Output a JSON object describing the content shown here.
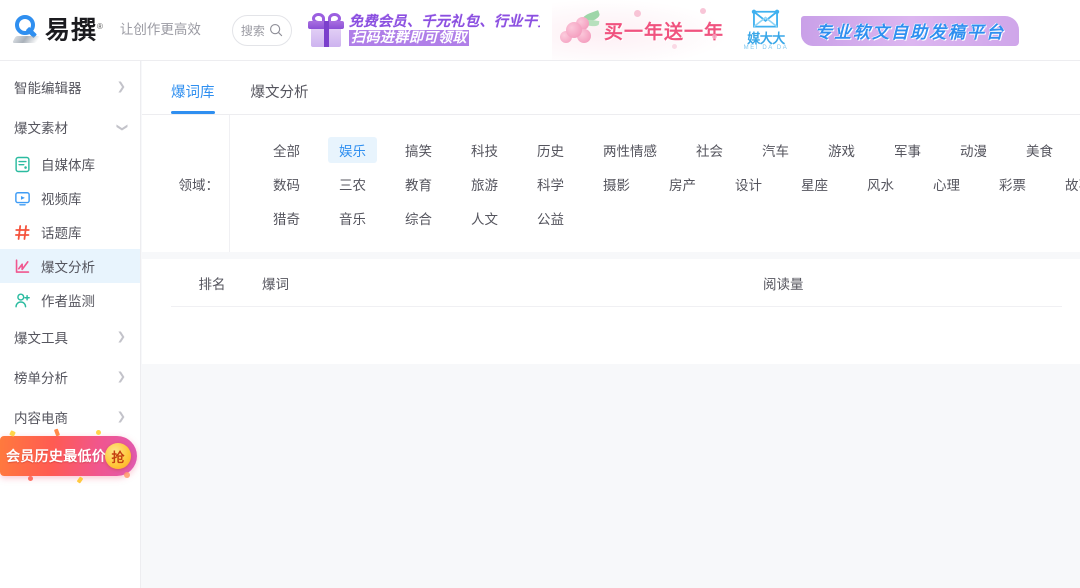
{
  "header": {
    "brand_name": "易撰",
    "brand_reg": "®",
    "tagline": "让创作更高效",
    "search": {
      "label": "搜索",
      "icon": "search-icon"
    },
    "banners": [
      {
        "id": "gift-membership",
        "icon": "gift-box-icon",
        "line1": "免费会员、千元礼包、行业干货",
        "line2": "扫码进群即可领取"
      },
      {
        "id": "buy-one-get-one",
        "icon": "flower-icon",
        "text": "买一年送一年"
      },
      {
        "id": "meida-platform",
        "logo_name": "媒大大",
        "logo_sub": "MEI DA DA",
        "text": "专业软文自助发稿平台"
      }
    ]
  },
  "sidebar": {
    "groups": [
      {
        "label": "智能编辑器",
        "state": "collapsed",
        "icon": "chevron-right-icon"
      },
      {
        "label": "爆文素材",
        "state": "expanded",
        "icon": "chevron-down-icon"
      }
    ],
    "items": [
      {
        "label": "自媒体库",
        "icon": "document-icon",
        "color": "#2bbba0",
        "active": false
      },
      {
        "label": "视频库",
        "icon": "video-icon",
        "color": "#3f9cf5",
        "active": false
      },
      {
        "label": "话题库",
        "icon": "hashtag-icon",
        "color": "#f5533d",
        "active": false
      },
      {
        "label": "爆文分析",
        "icon": "chart-line-icon",
        "color": "#f0568f",
        "active": true
      },
      {
        "label": "作者监测",
        "icon": "user-plus-icon",
        "color": "#2bbba0",
        "active": false
      }
    ],
    "groups_bottom": [
      {
        "label": "爆文工具",
        "state": "collapsed",
        "icon": "chevron-right-icon"
      },
      {
        "label": "榜单分析",
        "state": "collapsed",
        "icon": "chevron-right-icon"
      },
      {
        "label": "内容电商",
        "state": "collapsed",
        "icon": "chevron-right-icon"
      }
    ],
    "promo": {
      "text": "会员历史最低价",
      "button": "抢"
    }
  },
  "main": {
    "tabs": [
      {
        "label": "爆词库",
        "active": true
      },
      {
        "label": "爆文分析",
        "active": false
      }
    ],
    "filter": {
      "label": "领域：",
      "rows": [
        [
          {
            "label": "全部",
            "active": false
          },
          {
            "label": "娱乐",
            "active": true
          },
          {
            "label": "搞笑",
            "active": false
          },
          {
            "label": "科技",
            "active": false
          },
          {
            "label": "历史",
            "active": false
          },
          {
            "label": "两性情感",
            "active": false
          },
          {
            "label": "社会",
            "active": false
          },
          {
            "label": "汽车",
            "active": false
          },
          {
            "label": "游戏",
            "active": false
          },
          {
            "label": "军事",
            "active": false
          },
          {
            "label": "动漫",
            "active": false
          },
          {
            "label": "美食",
            "active": false
          }
        ],
        [
          {
            "label": "数码",
            "active": false
          },
          {
            "label": "三农",
            "active": false
          },
          {
            "label": "教育",
            "active": false
          },
          {
            "label": "旅游",
            "active": false
          },
          {
            "label": "科学",
            "active": false
          },
          {
            "label": "摄影",
            "active": false
          },
          {
            "label": "房产",
            "active": false
          },
          {
            "label": "设计",
            "active": false
          },
          {
            "label": "星座",
            "active": false
          },
          {
            "label": "风水",
            "active": false
          },
          {
            "label": "心理",
            "active": false
          },
          {
            "label": "彩票",
            "active": false
          },
          {
            "label": "故事",
            "active": false
          }
        ],
        [
          {
            "label": "猎奇",
            "active": false
          },
          {
            "label": "音乐",
            "active": false
          },
          {
            "label": "综合",
            "active": false
          },
          {
            "label": "人文",
            "active": false
          },
          {
            "label": "公益",
            "active": false
          }
        ]
      ]
    },
    "table": {
      "columns": [
        {
          "key": "rank",
          "label": "排名"
        },
        {
          "key": "word",
          "label": "爆词"
        },
        {
          "key": "reads",
          "label": "阅读量"
        }
      ],
      "rows": []
    }
  }
}
